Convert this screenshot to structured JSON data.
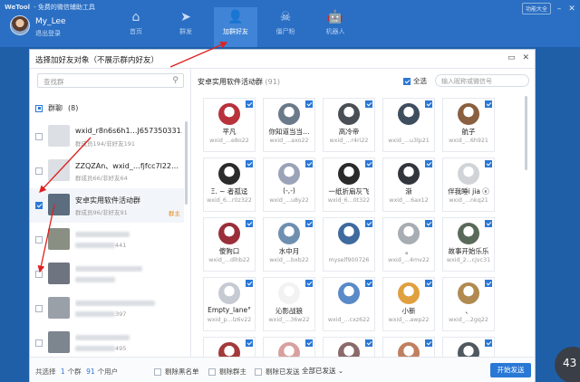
{
  "app": {
    "name": "WeTool",
    "subtitle": "- 免费的微信辅助工具",
    "user": {
      "name": "My_Lee",
      "status": "退出登录"
    },
    "nav": [
      {
        "icon": "home-icon",
        "glyph": "⌂",
        "label": "首页"
      },
      {
        "icon": "send-icon",
        "glyph": "➤",
        "label": "群发"
      },
      {
        "icon": "add-friend-icon",
        "glyph": "👤",
        "label": "加群好友"
      },
      {
        "icon": "zombie-icon",
        "glyph": "☠",
        "label": "僵尸粉"
      },
      {
        "icon": "robot-icon",
        "glyph": "🤖",
        "label": "机器人"
      }
    ],
    "top_right": {
      "all_features": "功能大全"
    },
    "corner_badge": "43"
  },
  "dialog": {
    "title": "选择加好友对象（不展示群内好友）",
    "search_placeholder": "查找群",
    "group_header": {
      "label": "群聊",
      "count": "(8)"
    },
    "groups": [
      {
        "name": "wxid_r8n6s6h1…J657350331…",
        "meta": "群成员194/非好友191",
        "checked": false,
        "avatar_color": "#dcdfe4",
        "tag": ""
      },
      {
        "name": "ZZQZAn、wxid_…fjfcc7l22…",
        "meta": "群成员66/非好友64",
        "checked": false,
        "avatar_color": "#dcdfe4",
        "tag": ""
      },
      {
        "name": "安卓实用软件活动群",
        "meta": "群成员96/非好友91",
        "checked": true,
        "avatar_color": "#5b6d7e",
        "tag": "群主"
      },
      {
        "name": "",
        "meta": "441",
        "checked": false,
        "avatar_color": "#8a8f84",
        "tag": ""
      },
      {
        "name": "",
        "meta": "",
        "checked": false,
        "avatar_color": "#6e7580",
        "tag": ""
      },
      {
        "name": "",
        "meta": "397",
        "checked": false,
        "avatar_color": "#9aa0a8",
        "tag": ""
      },
      {
        "name": "",
        "meta": "495",
        "checked": false,
        "avatar_color": "#7d858e",
        "tag": ""
      }
    ],
    "right": {
      "title": "安卓实用软件活动群",
      "count": "(91)",
      "select_all": "全选",
      "nick_placeholder": "输入昵称或微信号",
      "members": [
        {
          "name": "平凡",
          "wxid": "wxid_...e8o22",
          "color": "#b8323c"
        },
        {
          "name": "你知道当当…",
          "wxid": "wxid_...axo22",
          "color": "#6b7a8a"
        },
        {
          "name": "高冷帝",
          "wxid": "wxid_...r4ri22",
          "color": "#4a4f56"
        },
        {
          "name": "",
          "wxid": "wxid_...u3lp21",
          "color": "#3e4e5e"
        },
        {
          "name": "航子",
          "wxid": "wxid_...6h921",
          "color": "#8a6040"
        },
        {
          "name": "Ξ. ~ 者孤迳",
          "wxid": "wxid_6...r0z322",
          "color": "#2b2b2b"
        },
        {
          "name": "(-,-)",
          "wxid": "wxid_...u8y22",
          "color": "#9aa3b8"
        },
        {
          "name": "一纸折扇灰飞",
          "wxid": "wxid_6...0t322",
          "color": "#2a2a2a"
        },
        {
          "name": "渐",
          "wxid": "wxid_...6ax12",
          "color": "#32363c"
        },
        {
          "name": "伴我睡i jia ⓔ",
          "wxid": "wxid_...nkq21",
          "color": "#d0d4d8"
        },
        {
          "name": "傻狗口",
          "wxid": "wxid_...dlhb22",
          "color": "#9a2f3a"
        },
        {
          "name": "水中月",
          "wxid": "wxid_...bxb22",
          "color": "#6f8fb0"
        },
        {
          "name": "",
          "wxid": "myself900726",
          "color": "#3e6a9e"
        },
        {
          "name": "。",
          "wxid": "wxid_...4mv22",
          "color": "#a7adb3"
        },
        {
          "name": "故事开始乐乐",
          "wxid": "wxid_2...cjvc31",
          "color": "#5a6a5a"
        },
        {
          "name": "Empty_lane°",
          "wxid": "wxid_p...lz6v22",
          "color": "#c6cad2"
        },
        {
          "name": "沁影战狼",
          "wxid": "wxid_...36w22",
          "color": "#f2f2f2"
        },
        {
          "name": "",
          "wxid": "wxid_...cxz622",
          "color": "#5a8ac8"
        },
        {
          "name": "小新",
          "wxid": "wxid_...awp22",
          "color": "#e0a040"
        },
        {
          "name": "、",
          "wxid": "wxid_...2gq22",
          "color": "#b08a50"
        },
        {
          "name": "",
          "wxid": "",
          "color": "#a33a3a"
        },
        {
          "name": "",
          "wxid": "",
          "color": "#d9a0a0"
        },
        {
          "name": "",
          "wxid": "",
          "color": "#8a6a6a"
        },
        {
          "name": "",
          "wxid": "",
          "color": "#c08060"
        },
        {
          "name": "",
          "wxid": "",
          "color": "#505860"
        }
      ]
    },
    "footer": {
      "stat_prefix": "共选择",
      "groups_n": "1",
      "groups_unit": "个群",
      "users_n": "91",
      "users_unit": "个用户",
      "opt_blacklist": "剔除黑名单",
      "opt_owner": "剔除群主",
      "opt_sent": "剔除已发送",
      "send_filter": "全部已发送",
      "send_button": "开始发送"
    }
  },
  "colors": {
    "accent": "#2a78d6",
    "appbar": "#2a6fc4",
    "arrow": "#e02020"
  }
}
